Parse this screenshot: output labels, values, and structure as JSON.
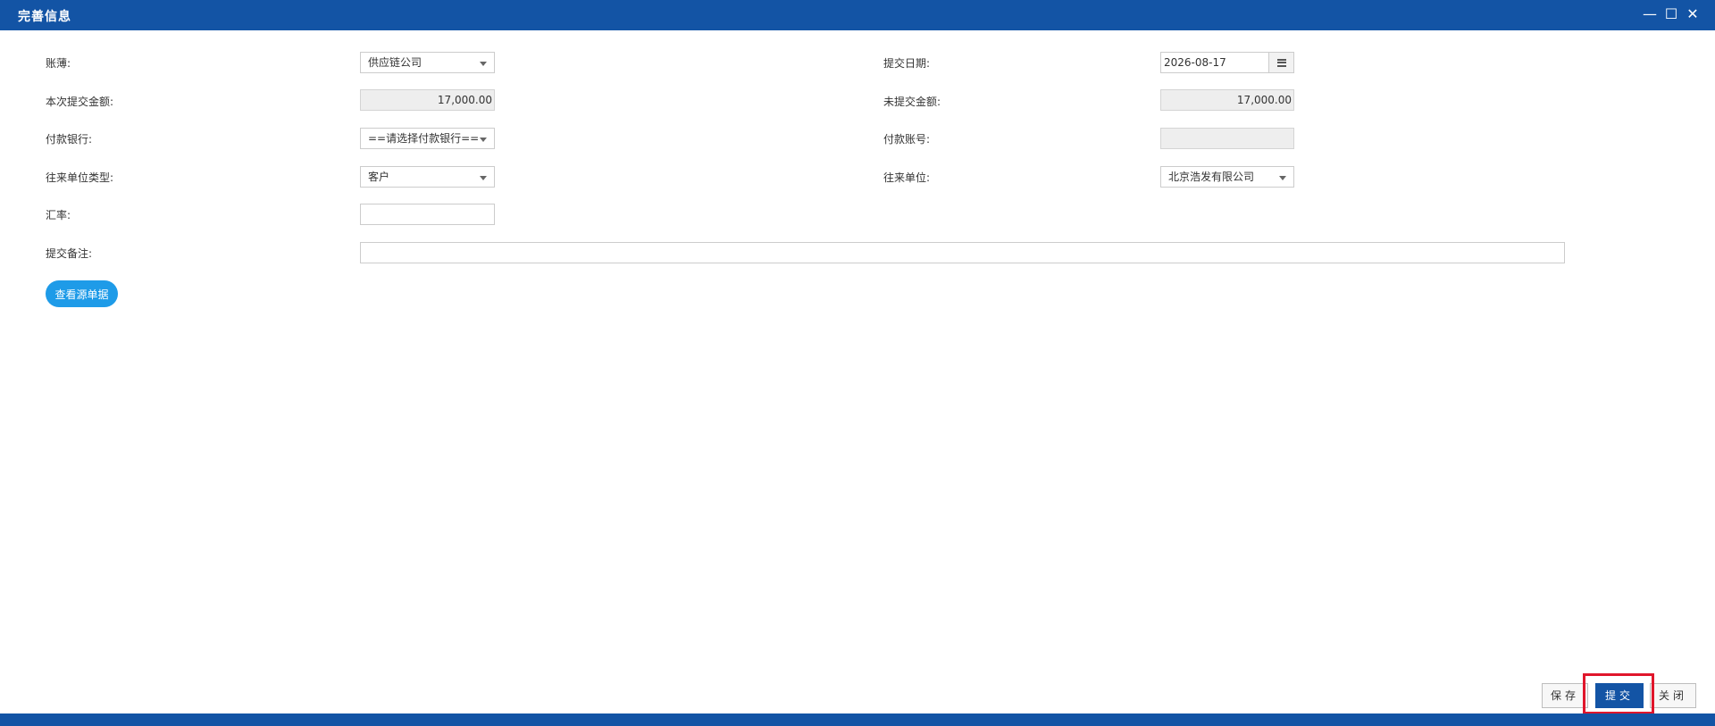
{
  "window": {
    "title": "完善信息",
    "controls": {
      "minimize": "—",
      "maximize": "☐",
      "close": "✕"
    }
  },
  "form": {
    "ledger": {
      "label": "账薄:",
      "value": "供应链公司"
    },
    "submit_date": {
      "label": "提交日期:",
      "value": "2026-08-17"
    },
    "this_amount": {
      "label": "本次提交金额:",
      "value": "17,000.00"
    },
    "unsubmitted_amount": {
      "label": "未提交金额:",
      "value": "17,000.00"
    },
    "pay_bank": {
      "label": "付款银行:",
      "value": "==请选择付款银行=="
    },
    "pay_account": {
      "label": "付款账号:",
      "value": ""
    },
    "partner_type": {
      "label": "往来单位类型:",
      "value": "客户"
    },
    "partner": {
      "label": "往来单位:",
      "value": "北京浩发有限公司"
    },
    "exchange_rate": {
      "label": "汇率:",
      "value": ""
    },
    "remark": {
      "label": "提交备注:",
      "value": ""
    }
  },
  "buttons": {
    "view_source": "查看源单据",
    "save": "保存",
    "submit": "提交",
    "close": "关闭"
  },
  "colors": {
    "titlebar": "#1354a5",
    "accent_pill": "#1e9be8",
    "highlight": "#e0162b"
  }
}
